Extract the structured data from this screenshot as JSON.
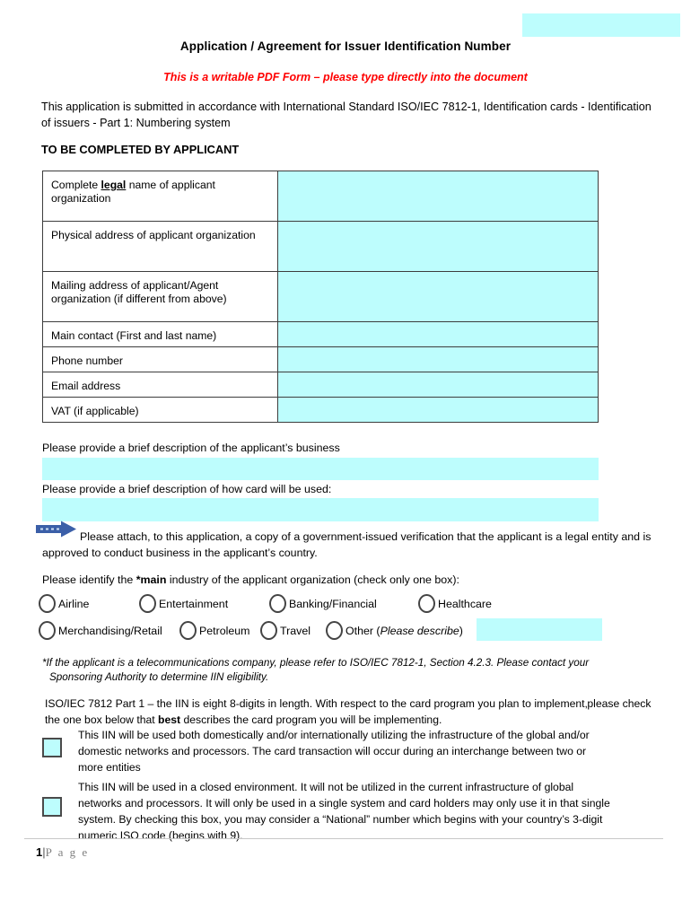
{
  "header": {
    "title": "Application / Agreement for Issuer Identification Number",
    "subtitle": "This is a writable PDF Form – please type directly into the document",
    "top_right_field_value": "",
    "intro": "This application is submitted in accordance with International Standard ISO/IEC 7812-1, Identification cards - Identification of issuers - Part 1: Numbering system",
    "section_heading": "TO BE COMPLETED BY APPLICANT"
  },
  "applicant_table": {
    "rows": [
      {
        "label_pre": "Complete ",
        "label_em": "legal",
        "label_post": " name of applicant organization",
        "value": "",
        "size": "tall"
      },
      {
        "label_pre": "Physical address of applicant organization",
        "label_em": "",
        "label_post": "",
        "value": "",
        "size": "tall"
      },
      {
        "label_pre": "Mailing address of applicant/Agent organization (if different from above)",
        "label_em": "",
        "label_post": "",
        "value": "",
        "size": "tall"
      },
      {
        "label_pre": "Main contact (First and last name)",
        "label_em": "",
        "label_post": "",
        "value": "",
        "size": "short"
      },
      {
        "label_pre": "Phone number",
        "label_em": "",
        "label_post": "",
        "value": "",
        "size": "short"
      },
      {
        "label_pre": "Email address",
        "label_em": "",
        "label_post": "",
        "value": "",
        "size": "short"
      },
      {
        "label_pre": "VAT (if applicable)",
        "label_em": "",
        "label_post": "",
        "value": "",
        "size": "short"
      }
    ]
  },
  "descriptions": {
    "business_label": "Please provide a brief description of the applicant’s business",
    "business_value": "",
    "card_use_label": "Please provide a brief description of how card will be used:",
    "card_use_value": ""
  },
  "attachment_note": "Please attach, to this application, a copy of a government-issued verification that the applicant is a legal entity and  is approved to conduct business in the applicant’s country.",
  "industry": {
    "question_pre": "Please identify the ",
    "question_em": "*main",
    "question_post": " industry of the applicant organization (check only one box):",
    "options_row1": [
      "Airline",
      "Entertainment",
      "Banking/Financial",
      "Healthcare"
    ],
    "options_row2_plain": [
      "Merchandising/Retail",
      "Petroleum",
      "Travel"
    ],
    "other_label_pre": "Other (",
    "other_label_em": "Please describe",
    "other_label_post": ")",
    "other_value": "",
    "footnote_line1": "*If the applicant is a telecommunications company, please refer to ISO/IEC 7812-1, Section 4.2.3.  Please contact your",
    "footnote_line2": "Sponsoring Authority to determine IIN eligibility."
  },
  "iin": {
    "intro_line1": "ISO/IEC 7812 Part 1 – the IIN is eight 8-digits in length.  With respect to the card program you plan to implement,",
    "intro_line2_pre": "please check the one box below that ",
    "intro_line2_em": "best",
    "intro_line2_post": " describes the card program you will be implementing.",
    "option1_text": "This IIN will be used both domestically and/or internationally utilizing the infrastructure of the global and/or domestic networks and processors.  The card transaction will occur during an interchange between two or more entities",
    "option1_checked": false,
    "option2_text": "This IIN will be used in a closed environment.  It will not be utilized in the current infrastructure of global networks and processors.   It will only be used in a single system and card holders may only use it in that single system.  By checking this box, you may consider a “National” number which begins with your country’s 3-digit numeric ISO code (begins with 9).",
    "option2_checked": false
  },
  "footer": {
    "page_number": "1",
    "separator": "|",
    "page_word": "P a g e"
  },
  "colors": {
    "field_fill": "#bdfdfd",
    "accent_red": "#ff0000",
    "arrow_blue": "#3b5fa8",
    "border": "#3d3d3d"
  }
}
